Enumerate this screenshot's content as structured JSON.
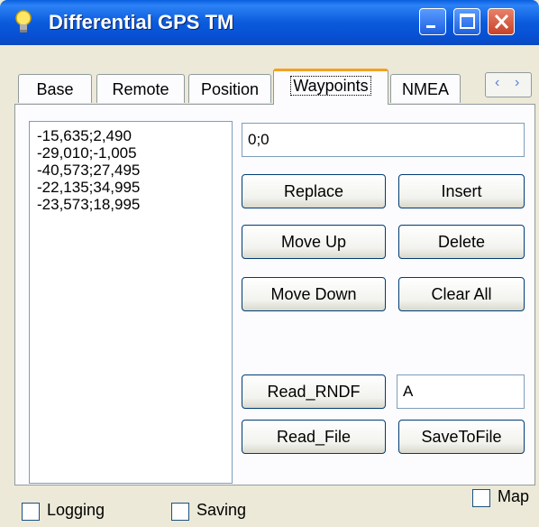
{
  "window": {
    "title": "Differential GPS TM",
    "icon": "lightbulb-icon",
    "title_buttons": [
      "minimize-icon",
      "maximize-icon",
      "close-icon"
    ]
  },
  "tabs": [
    {
      "label": "Base"
    },
    {
      "label": "Remote"
    },
    {
      "label": "Position"
    },
    {
      "label": "Waypoints",
      "active": true
    },
    {
      "label": "NMEA"
    }
  ],
  "tab_scroll": {
    "left": "‹",
    "right": "›"
  },
  "waypoints": {
    "list": [
      "-15,635;2,490",
      "-29,010;-1,005",
      "-40,573;27,495",
      "-22,135;34,995",
      "-23,573;18,995"
    ],
    "coordinate_input": "0;0",
    "buttons": {
      "replace": "Replace",
      "insert": "Insert",
      "move_up": "Move Up",
      "delete": "Delete",
      "move_down": "Move Down",
      "clear_all": "Clear All",
      "read_rndf": "Read_RNDF",
      "read_file": "Read_File",
      "save_to_file": "SaveToFile"
    },
    "rndf_input": "A"
  },
  "footer": {
    "logging": {
      "label": "Logging",
      "checked": false
    },
    "saving": {
      "label": "Saving",
      "checked": false
    },
    "map": {
      "label": "Map",
      "checked": false
    }
  },
  "colors": {
    "titlebar": "#0A5FE0",
    "window_bg": "#ECE9D8",
    "active_tab_accent": "#F4A020",
    "button_border": "#003C74"
  }
}
